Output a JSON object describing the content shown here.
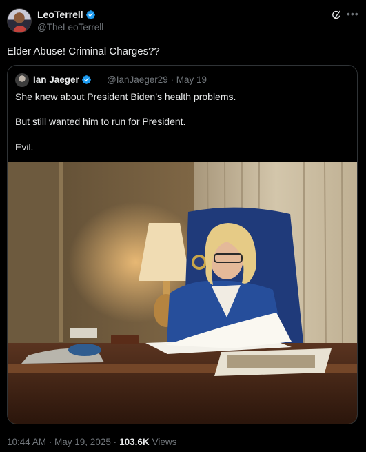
{
  "tweet": {
    "author_name": "LeoTerrell",
    "author_handle": "@TheLeoTerrell",
    "text": "Elder Abuse! Criminal Charges??",
    "timestamp": "10:44 AM · May 19, 2025 ·",
    "views_count": "103.6K",
    "views_label": "Views"
  },
  "quoted": {
    "author_name": "Ian Jaeger",
    "author_handle": "@IanJaeger29 · May 19",
    "lines": [
      "She knew about President Biden’s health problems.",
      "But still wanted him to run for President.",
      "Evil."
    ]
  },
  "icons": {
    "verified": "verified-badge-icon",
    "grok": "grok-icon",
    "more": "more-icon"
  },
  "colors": {
    "background": "#000000",
    "text": "#e7e9ea",
    "muted": "#71767b",
    "verified": "#1d9bf0",
    "border": "#2f3336"
  }
}
